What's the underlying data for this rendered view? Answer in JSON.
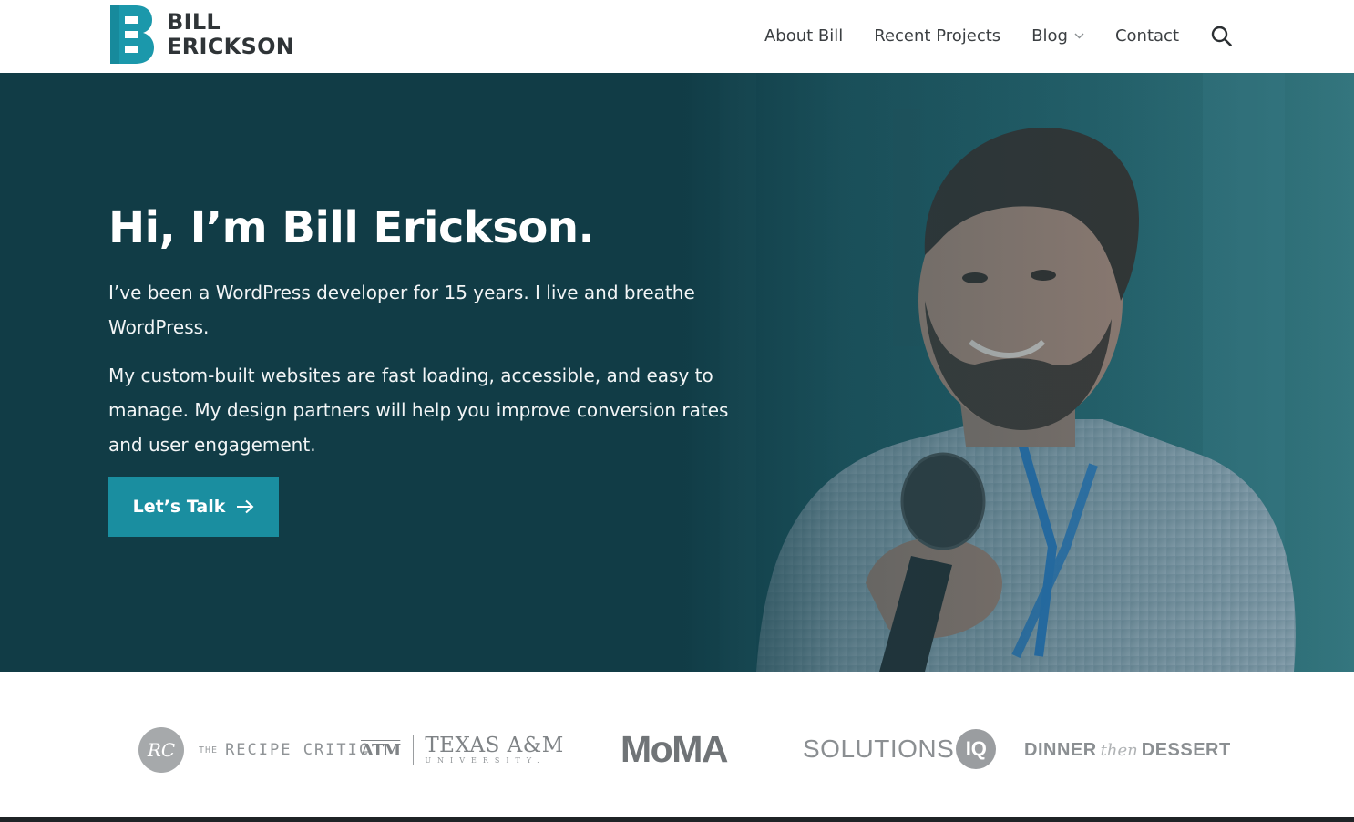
{
  "header": {
    "logo": {
      "line1": "BILL",
      "line2": "ERICKSON",
      "icon": "logo-b-mark"
    },
    "nav": [
      {
        "label": "About Bill"
      },
      {
        "label": "Recent Projects"
      },
      {
        "label": "Blog",
        "icon": "chevron-down-icon"
      },
      {
        "label": "Contact"
      }
    ],
    "search_icon": "search-icon"
  },
  "hero": {
    "title": "Hi, I’m Bill Erickson.",
    "paragraph1": "I’ve been a WordPress developer for 15 years. I live and breathe WordPress.",
    "paragraph2": "My custom-built websites are fast loading, accessible, and easy to manage. My design partners will help you improve conversion rates and user engagement.",
    "cta_label": "Let’s Talk",
    "cta_icon": "arrow-right-icon"
  },
  "clients": {
    "recipe_critic": {
      "monogram": "RC",
      "prefix": "THE",
      "name": "RECIPE CRITIC"
    },
    "texas_am": {
      "mark": "ATM",
      "name": "TEXAS A&M",
      "sub": "UNIVERSITY."
    },
    "moma": {
      "name": "MoMA"
    },
    "solutions_iq": {
      "name": "SOLUTIONS",
      "badge": "IQ"
    },
    "dinner_dessert": {
      "word1": "DINNER",
      "script": "then",
      "word2": "DESSERT"
    }
  },
  "colors": {
    "brand_teal": "#1a8ea0",
    "hero_dark": "#113c46",
    "logo_teal": "#1b98ab",
    "client_gray": "#8b8f92"
  }
}
